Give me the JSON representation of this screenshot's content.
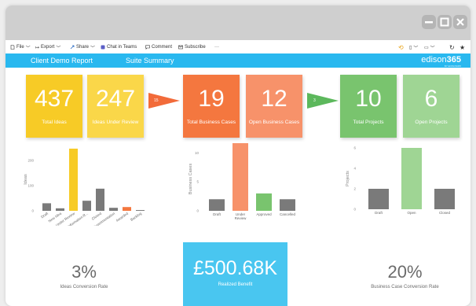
{
  "window": {
    "controls": [
      "minimize",
      "maximize",
      "close"
    ]
  },
  "toolbar": {
    "file": "File",
    "export": "Export",
    "share": "Share",
    "chat": "Chat in Teams",
    "comment": "Comment",
    "subscribe": "Subscribe",
    "more": "···"
  },
  "header": {
    "tab1": "Client Demo Report",
    "tab2": "Suite Summary",
    "brand_main": "edison",
    "brand_num": "365",
    "brand_sub": "BY EDISON365"
  },
  "tiles": [
    {
      "value": "437",
      "label": "Total Ideas",
      "color": "#f7cb26"
    },
    {
      "value": "247",
      "label": "Ideas Under Review",
      "color": "#fad749"
    },
    {
      "value": "19",
      "label": "Total Business Cases",
      "color": "#f4773f"
    },
    {
      "value": "12",
      "label": "Open Business Cases",
      "color": "#f7926a"
    },
    {
      "value": "10",
      "label": "Total Projects",
      "color": "#79c46e"
    },
    {
      "value": "6",
      "label": "Open Projects",
      "color": "#9fd594"
    }
  ],
  "arrows": [
    {
      "label": "15",
      "color": "#f26b3a"
    },
    {
      "label": "3",
      "color": "#5cb85c"
    }
  ],
  "chart_data": [
    {
      "type": "bar",
      "ylabel": "Ideas",
      "ylim": [
        0,
        250
      ],
      "yticks": [
        0,
        100,
        200
      ],
      "categories": [
        "Draft",
        "New Idea",
        "Under Review",
        "More Information R...",
        "Closed",
        "Experimentation",
        "Awarded",
        "Backlog"
      ],
      "values": [
        30,
        10,
        247,
        40,
        88,
        12,
        15,
        3
      ],
      "colors": [
        "#7a7a7a",
        "#7a7a7a",
        "#f7cb26",
        "#7a7a7a",
        "#7a7a7a",
        "#7a7a7a",
        "#f4773f",
        "#7a7a7a"
      ]
    },
    {
      "type": "bar",
      "ylabel": "Business Cases",
      "ylim": [
        0,
        11
      ],
      "yticks": [
        0,
        5,
        10
      ],
      "categories": [
        "Draft",
        "Under Review",
        "Approved",
        "Cancelled"
      ],
      "values": [
        2,
        12,
        3,
        2
      ],
      "colors": [
        "#7a7a7a",
        "#f7926a",
        "#79c46e",
        "#7a7a7a"
      ]
    },
    {
      "type": "bar",
      "ylabel": "Projects",
      "ylim": [
        0,
        6
      ],
      "yticks": [
        0,
        2,
        4,
        6
      ],
      "categories": [
        "Draft",
        "Open",
        "Closed"
      ],
      "values": [
        2,
        6,
        2
      ],
      "colors": [
        "#7a7a7a",
        "#9fd594",
        "#7a7a7a"
      ]
    }
  ],
  "kpis": {
    "ideas_rate": "3%",
    "ideas_rate_label": "Ideas Conversion Rate",
    "benefit": "£500.68K",
    "benefit_label": "Realized Benefit",
    "bc_rate": "20%",
    "bc_rate_label": "Business Case Conversion Rate"
  }
}
